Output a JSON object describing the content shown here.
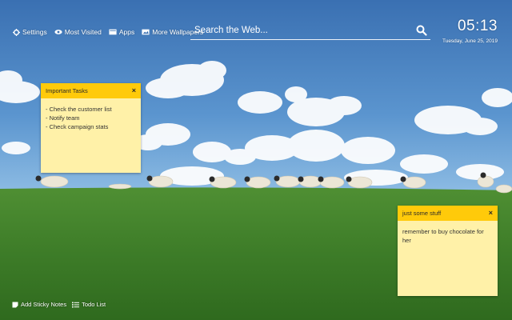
{
  "nav": {
    "settings": "Settings",
    "most_visited": "Most Visited",
    "apps": "Apps",
    "more_wallpapers": "More Wallpapers"
  },
  "search": {
    "placeholder": "Search the Web..."
  },
  "clock": {
    "time": "05:13",
    "date": "Tuesday, June 25, 2019"
  },
  "notes": [
    {
      "title": "Important Tasks",
      "close": "×",
      "items": [
        "- Check the customer list",
        "- Notify team",
        "- Check campaign stats"
      ]
    },
    {
      "title": "just some stuff",
      "close": "×",
      "body": "remember to buy chocolate for her"
    }
  ],
  "bottom": {
    "add_sticky_notes": "Add Sticky Notes",
    "todo_list": "Todo List"
  },
  "colors": {
    "note_header": "#ffca0a",
    "note_body": "#fff1a8",
    "sky": "#3f78b8",
    "grass": "#3f7d2a"
  },
  "icons": [
    "gear-icon",
    "eye-icon",
    "apps-icon",
    "wallpaper-icon",
    "search-icon",
    "sticky-note-icon",
    "todo-list-icon"
  ]
}
